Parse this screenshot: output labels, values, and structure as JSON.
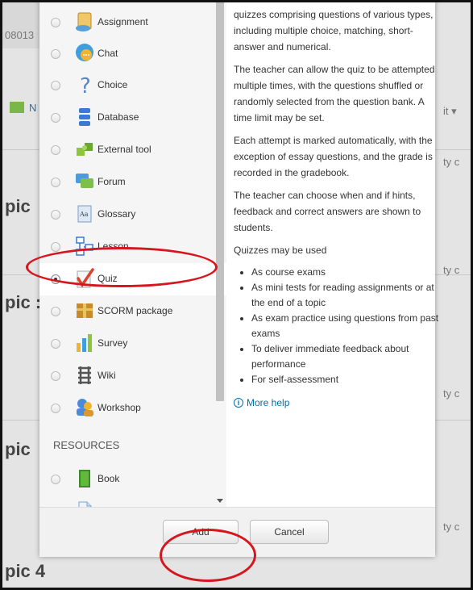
{
  "background": {
    "left_fragments": [
      "08013",
      "N"
    ],
    "right_fragments": [
      "it ▾",
      "ty c",
      "ty c",
      "ty c",
      "ty c"
    ],
    "topics": [
      "pic",
      "pic :",
      "pic",
      "pic 4"
    ]
  },
  "options": [
    {
      "label": "Assignment",
      "icon": "assignment-icon",
      "selected": false
    },
    {
      "label": "Chat",
      "icon": "chat-icon",
      "selected": false
    },
    {
      "label": "Choice",
      "icon": "choice-icon",
      "selected": false
    },
    {
      "label": "Database",
      "icon": "database-icon",
      "selected": false
    },
    {
      "label": "External tool",
      "icon": "external-tool-icon",
      "selected": false
    },
    {
      "label": "Forum",
      "icon": "forum-icon",
      "selected": false
    },
    {
      "label": "Glossary",
      "icon": "glossary-icon",
      "selected": false
    },
    {
      "label": "Lesson",
      "icon": "lesson-icon",
      "selected": false
    },
    {
      "label": "Quiz",
      "icon": "quiz-icon",
      "selected": true
    },
    {
      "label": "SCORM package",
      "icon": "scorm-icon",
      "selected": false
    },
    {
      "label": "Survey",
      "icon": "survey-icon",
      "selected": false
    },
    {
      "label": "Wiki",
      "icon": "wiki-icon",
      "selected": false
    },
    {
      "label": "Workshop",
      "icon": "workshop-icon",
      "selected": false
    }
  ],
  "resources_heading": "RESOURCES",
  "resources": [
    {
      "label": "Book",
      "icon": "book-icon",
      "selected": false
    },
    {
      "label": "File",
      "icon": "file-icon",
      "selected": false
    }
  ],
  "help": {
    "paragraphs": [
      "quizzes comprising questions of various types, including multiple choice, matching, short-answer and numerical.",
      "The teacher can allow the quiz to be attempted multiple times, with the questions shuffled or randomly selected from the question bank. A time limit may be set.",
      "Each attempt is marked automatically, with the exception of essay questions, and the grade is recorded in the gradebook.",
      "The teacher can choose when and if hints, feedback and correct answers are shown to students.",
      "Quizzes may be used"
    ],
    "bullets": [
      "As course exams",
      "As mini tests for reading assignments or at the end of a topic",
      "As exam practice using questions from past exams",
      "To deliver immediate feedback about performance",
      "For self-assessment"
    ],
    "more_help": "More help"
  },
  "buttons": {
    "add": "Add",
    "cancel": "Cancel"
  },
  "colors": {
    "annotation": "#d6161f",
    "link": "#0070a8"
  }
}
